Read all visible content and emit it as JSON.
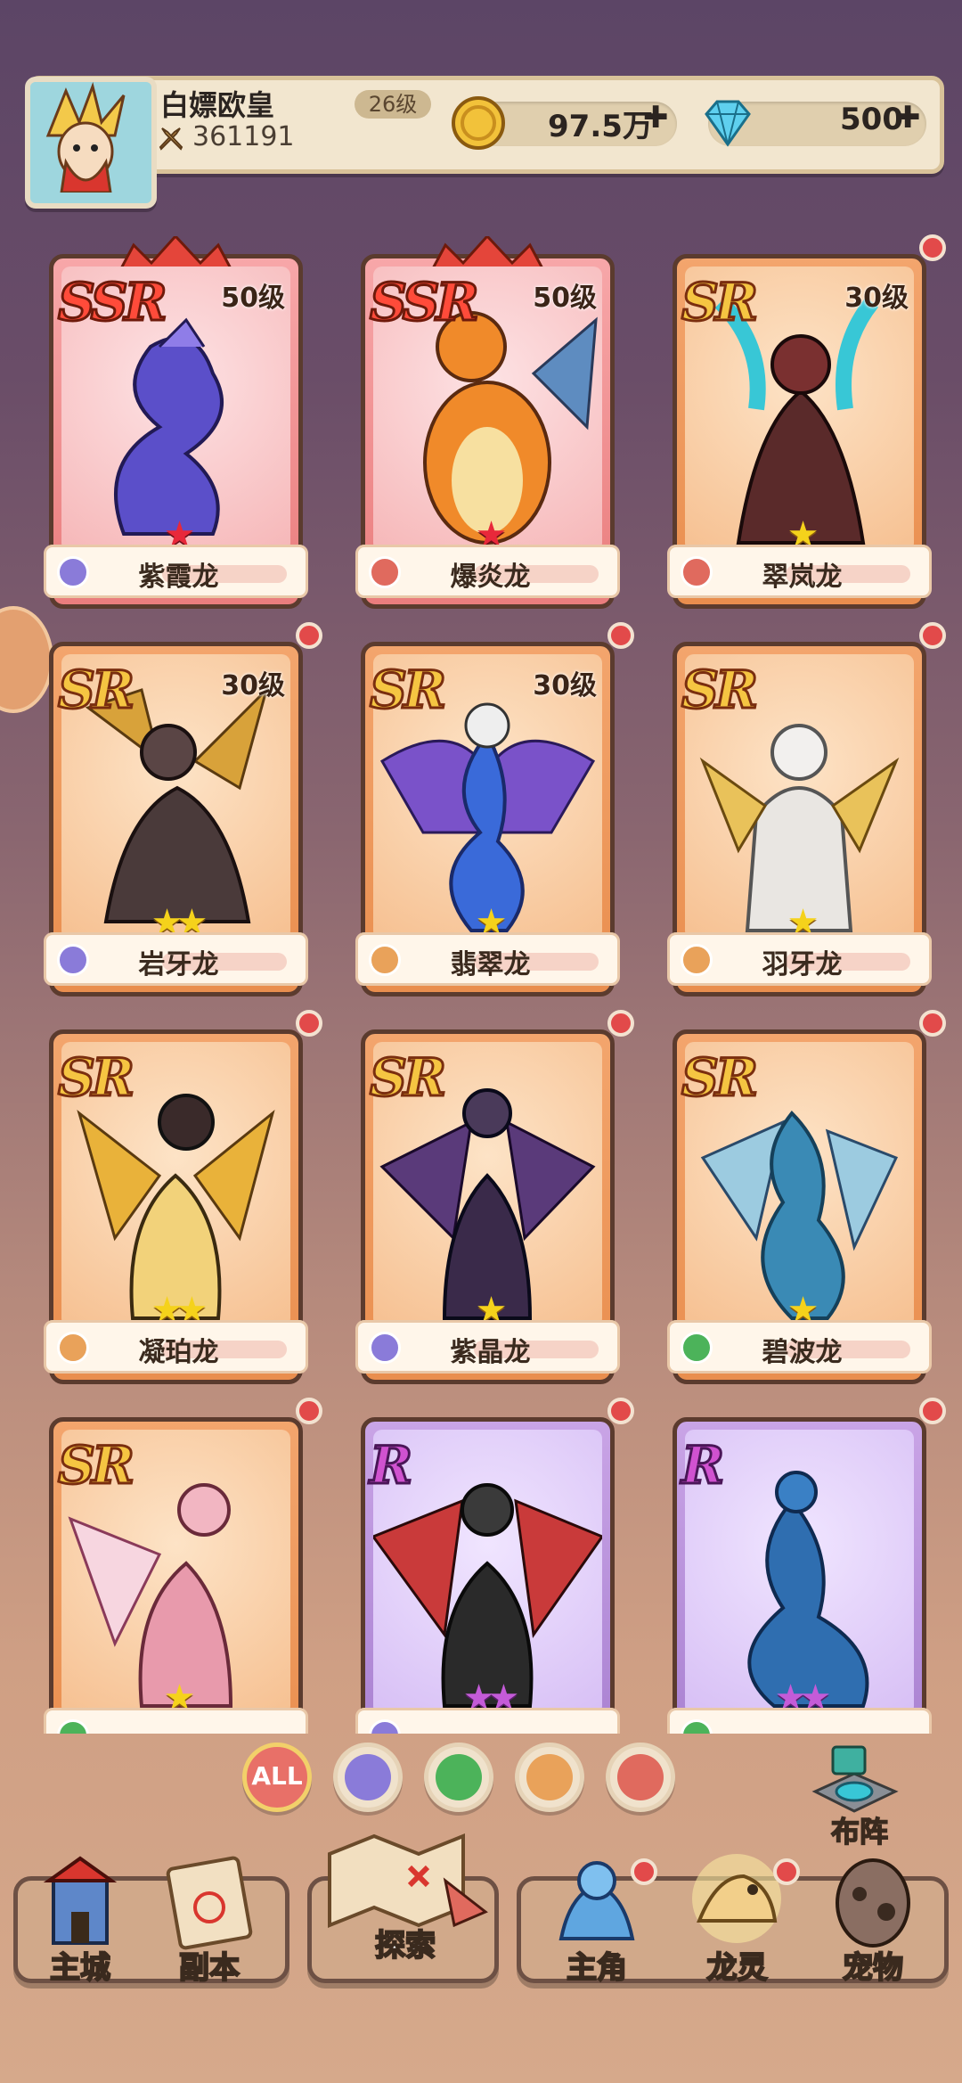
{
  "player": {
    "name": "白嫖欧皇",
    "level": "26级",
    "power": "361191",
    "gold": "97.5万",
    "diamonds": "500"
  },
  "cards": [
    {
      "rarity": "SSR",
      "level": "50级",
      "name": "紫霞龙",
      "stars": "★",
      "element": "water",
      "dot": false
    },
    {
      "rarity": "SSR",
      "level": "50级",
      "name": "爆炎龙",
      "stars": "★",
      "element": "fire",
      "dot": false
    },
    {
      "rarity": "SR",
      "level": "30级",
      "name": "翠岚龙",
      "stars": "★",
      "element": "fire",
      "dot": true
    },
    {
      "rarity": "SR",
      "level": "30级",
      "name": "岩牙龙",
      "stars": "★★",
      "element": "water",
      "dot": true
    },
    {
      "rarity": "SR",
      "level": "30级",
      "name": "翡翠龙",
      "stars": "★",
      "element": "light",
      "dot": true
    },
    {
      "rarity": "SR",
      "level": "",
      "name": "羽牙龙",
      "stars": "★",
      "element": "light",
      "dot": true
    },
    {
      "rarity": "SR",
      "level": "",
      "name": "凝珀龙",
      "stars": "★★",
      "element": "light",
      "dot": true
    },
    {
      "rarity": "SR",
      "level": "",
      "name": "紫晶龙",
      "stars": "★",
      "element": "water",
      "dot": true
    },
    {
      "rarity": "SR",
      "level": "",
      "name": "碧波龙",
      "stars": "★",
      "element": "wind",
      "dot": true
    },
    {
      "rarity": "SR",
      "level": "",
      "name": "",
      "stars": "★",
      "element": "wind",
      "dot": true
    },
    {
      "rarity": "R",
      "level": "",
      "name": "",
      "stars": "★★",
      "element": "water",
      "dot": true
    },
    {
      "rarity": "R",
      "level": "",
      "name": "",
      "stars": "★★",
      "element": "wind",
      "dot": true
    }
  ],
  "filters": {
    "all_label": "ALL"
  },
  "formation_label": "布阵",
  "nav": {
    "city": "主城",
    "dungeon": "副本",
    "explore": "探索",
    "hero": "主角",
    "dragon": "龙灵",
    "pet": "宠物"
  },
  "colors": {
    "water": "#8a7bd9",
    "fire": "#e06a5e",
    "light": "#e9a25a",
    "wind": "#4cb35a",
    "accent_red": "#e24a4a"
  }
}
